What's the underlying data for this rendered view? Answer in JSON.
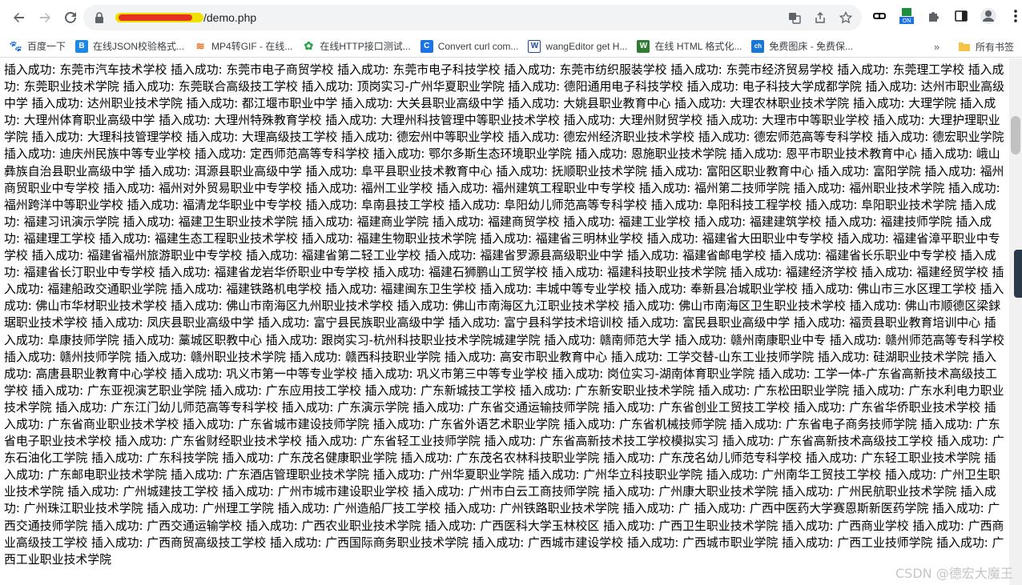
{
  "browser": {
    "url_path": "/demo.php",
    "bookmarks": [
      {
        "label": "百度一下",
        "icon": "baidu-paw-icon",
        "color": "#2932e1"
      },
      {
        "label": "在线JSON校验格式...",
        "icon": "b-letter-icon",
        "color": "#1e88e5"
      },
      {
        "label": "MP4转GIF - 在线...",
        "icon": "fire-icon",
        "color": "#e8711c"
      },
      {
        "label": "在线HTTP接口测试...",
        "icon": "gear-green-icon",
        "color": "#2ea44f"
      },
      {
        "label": "Convert curl com...",
        "icon": "c-letter-icon",
        "color": "#1a73e8"
      },
      {
        "label": "wangEditor get H...",
        "icon": "w-letter-icon",
        "color": "#1e4b9a"
      },
      {
        "label": "在线 HTML 格式化...",
        "icon": "w-green-icon",
        "color": "#2e7d32"
      },
      {
        "label": "免费图床 - 免费保...",
        "icon": "ch-letter-icon",
        "color": "#1976d2"
      }
    ],
    "more_bookmarks": "»",
    "all_bookmarks": "所有书签",
    "ext_badge": "ON"
  },
  "page": {
    "text": "插入成功: 东莞市汽车技术学校 插入成功: 东莞市电子商贸学校 插入成功: 东莞市电子科技学校 插入成功: 东莞市纺织服装学校 插入成功: 东莞市经济贸易学校 插入成功: 东莞理工学校 插入成功: 东莞职业技术学院 插入成功: 东莞联合高级技工学校 插入成功: 顶岗实习-广州华夏职业学院 插入成功: 德阳通用电子科技学校 插入成功: 电子科技大学成都学院 插入成功: 达州市职业高级中学 插入成功: 达州职业技术学院 插入成功: 都江堰市职业中学 插入成功: 大关县职业高级中学 插入成功: 大姚县职业教育中心 插入成功: 大理农林职业技术学院 插入成功: 大理学院 插入成功: 大理州体育职业高级中学 插入成功: 大理州特殊教育学校 插入成功: 大理州科技管理中等职业技术学校 插入成功: 大理州财贸学校 插入成功: 大理市中等职业学校 插入成功: 大理护理职业学院 插入成功: 大理科技管理学校 插入成功: 大理高级技工学校 插入成功: 德宏州中等职业学校 插入成功: 德宏州经济职业技术学校 插入成功: 德宏师范高等专科学校 插入成功: 德宏职业学院 插入成功: 迪庆州民族中等专业学校 插入成功: 定西师范高等专科学校 插入成功: 鄂尔多斯生态环境职业学院 插入成功: 恩施职业技术学院 插入成功: 恩平市职业技术教育中心 插入成功: 峨山彝族自治县职业高级中学 插入成功: 洱源县职业高级中学 插入成功: 阜平县职业技术教育中心 插入成功: 抚顺职业技术学院 插入成功: 富阳区职业教育中心 插入成功: 富阳学院 插入成功: 福州商贸职业中专学校 插入成功: 福州对外贸易职业中专学校 插入成功: 福州工业学校 插入成功: 福州建筑工程职业中专学校 插入成功: 福州第二技师学院 插入成功: 福州职业技术学院 插入成功: 福州跨洋中等职业学校 插入成功: 福清龙华职业中专学校 插入成功: 阜南县技工学校 插入成功: 阜阳幼儿师范高等专科学校 插入成功: 阜阳科技工程学校 插入成功: 阜阳职业技术学院 插入成功: 福建习讯演示学院 插入成功: 福建卫生职业技术学院 插入成功: 福建商业学院 插入成功: 福建商贸学校 插入成功: 福建工业学校 插入成功: 福建建筑学校 插入成功: 福建技师学院 插入成功: 福建理工学校 插入成功: 福建生态工程职业技术学校 插入成功: 福建生物职业技术学院 插入成功: 福建省三明林业学校 插入成功: 福建省大田职业中专学校 插入成功: 福建省漳平职业中专学校 插入成功: 福建省福州旅游职业中专学校 插入成功: 福建省第二轻工业学校 插入成功: 福建省罗源县高级职业中学 插入成功: 福建省邮电学校 插入成功: 福建省长乐职业中专学校 插入成功: 福建省长汀职业中专学校 插入成功: 福建省龙岩华侨职业中专学校 插入成功: 福建石狮鹏山工贸学校 插入成功: 福建科技职业技术学院 插入成功: 福建经济学校 插入成功: 福建经贸学校 插入成功: 福建船政交通职业学院 插入成功: 福建铁路机电学校 插入成功: 福建闽东卫生学校 插入成功: 丰城中等专业学校 插入成功: 奉新县冶城职业学校 插入成功: 佛山市三水区理工学校 插入成功: 佛山市华材职业技术学校 插入成功: 佛山市南海区九州职业技术学校 插入成功: 佛山市南海区九江职业技术学校 插入成功: 佛山市南海区卫生职业技术学校 插入成功: 佛山市顺德区梁銶琚职业技术学校 插入成功: 凤庆县职业高级中学 插入成功: 富宁县民族职业高级中学 插入成功: 富宁县科学技术培训校 插入成功: 富民县职业高级中学 插入成功: 福贡县职业教育培训中心 插入成功: 阜康技师学院 插入成功: 藁城区职教中心 插入成功: 跟岗实习-杭州科技职业技术学院城建学院 插入成功: 赣南师范大学 插入成功: 赣州南康职业中专 插入成功: 赣州师范高等专科学校 插入成功: 赣州技师学院 插入成功: 赣州职业技术学院 插入成功: 赣西科技职业学院 插入成功: 高安市职业教育中心 插入成功: 工学交替-山东工业技师学院 插入成功: 硅湖职业技术学院 插入成功: 高唐县职业教育中心学校 插入成功: 巩义市第一中等专业学校 插入成功: 巩义市第三中等专业学校 插入成功: 岗位实习-湖南体育职业学院 插入成功: 工学一体-广东省高新技术高级技工学校 插入成功: 广东亚视演艺职业学院 插入成功: 广东应用技工学校 插入成功: 广东新城技工学校 插入成功: 广东新安职业技术学院 插入成功: 广东松田职业学院 插入成功: 广东水利电力职业技术学院 插入成功: 广东江门幼儿师范高等专科学校 插入成功: 广东演示学院 插入成功: 广东省交通运输技师学院 插入成功: 广东省创业工贸技工学校 插入成功: 广东省华侨职业技术学校 插入成功: 广东省商业职业技术学校 插入成功: 广东省城市建设技师学院 插入成功: 广东省外语艺术职业学院 插入成功: 广东省机械技师学院 插入成功: 广东省电子商务技师学院 插入成功: 广东省电子职业技术学校 插入成功: 广东省财经职业技术学校 插入成功: 广东省轻工业技师学院 插入成功: 广东省高新技术技工学校模拟实习 插入成功: 广东省高新技术高级技工学校 插入成功: 广东石油化工学院 插入成功: 广东科技学院 插入成功: 广东茂名健康职业学院 插入成功: 广东茂名农林科技职业学院 插入成功: 广东茂名幼儿师范专科学校 插入成功: 广东轻工职业技术学院 插入成功: 广东邮电职业技术学院 插入成功: 广东酒店管理职业技术学院 插入成功: 广州华夏职业学院 插入成功: 广州华立科技职业学院 插入成功: 广州南华工贸技工学校 插入成功: 广州卫生职业技术学院 插入成功: 广州城建技工学校 插入成功: 广州市城市建设职业学校 插入成功: 广州市白云工商技师学院 插入成功: 广州康大职业技术学院 插入成功: 广州民航职业技术学院 插入成功: 广州珠江职业技术学院 插入成功: 广州理工学院 插入成功: 广州造船厂技工学校 插入成功: 广州铁路职业技术学院 插入成功: 广 插入成功: 广西中医药大学赛恩斯新医药学院 插入成功: 广西交通技师学院 插入成功: 广西交通运输学校 插入成功: 广西农业职业技术学院 插入成功: 广西医科大学玉林校区 插入成功: 广西卫生职业技术学院 插入成功: 广西商业学校 插入成功: 广西商业高级技工学校 插入成功: 广西商贸高级技工学校 插入成功: 广西国际商务职业技术学院 插入成功: 广西城市建设学校 插入成功: 广西城市职业学院 插入成功: 广西工业技师学院 插入成功: 广西工业职业技术学院",
    "watermark": "CSDN @德宏大魔王"
  }
}
